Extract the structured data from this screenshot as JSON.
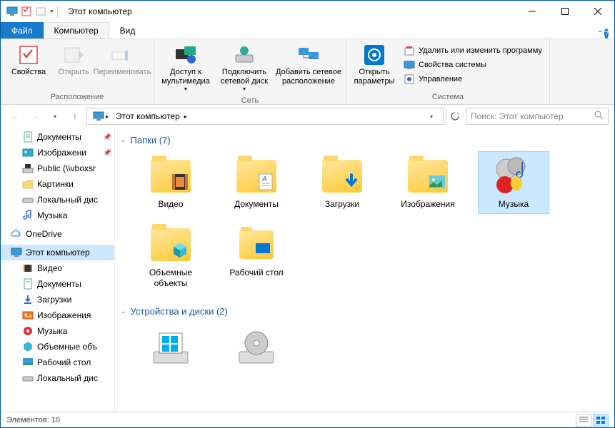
{
  "titlebar": {
    "title": "Этот компьютер"
  },
  "tabs": {
    "file": "Файл",
    "computer": "Компьютер",
    "view": "Вид"
  },
  "ribbon": {
    "loc_group": "Расположение",
    "properties": "Свойства",
    "open": "Открыть",
    "rename": "Переименовать",
    "net_group": "Сеть",
    "media": "Доступ к мультимедиа",
    "map_drive": "Подключить сетевой диск",
    "add_loc": "Добавить сетевое расположение",
    "sys_group": "Система",
    "settings": "Открыть параметры",
    "uninstall": "Удалить или изменить программу",
    "sysprops": "Свойства системы",
    "manage": "Управление"
  },
  "breadcrumb": {
    "this_pc": "Этот компьютер"
  },
  "search": {
    "placeholder": "Поиск: Этот компьютер"
  },
  "nav": {
    "documents": "Документы",
    "images": "Изображени",
    "public": "Public (\\\\vboxsr",
    "pictures": "Картинки",
    "local_disk": "Локальный дис",
    "music": "Музыка",
    "onedrive": "OneDrive",
    "this_pc": "Этот компьютер",
    "videos": "Видео",
    "documents2": "Документы",
    "downloads": "Загрузки",
    "images2": "Изображения",
    "music2": "Музыка",
    "objects3d": "Объемные объ",
    "desktop": "Рабочий стол",
    "local_disk2": "Локальный дис"
  },
  "sections": {
    "folders": "Папки (7)",
    "drives": "Устройства и диски (2)"
  },
  "items": {
    "videos": "Видео",
    "documents": "Документы",
    "downloads": "Загрузки",
    "images": "Изображения",
    "music": "Музыка",
    "objects3d": "Объемные объекты",
    "desktop": "Рабочий стол"
  },
  "status": {
    "count": "Элементов: 10"
  }
}
